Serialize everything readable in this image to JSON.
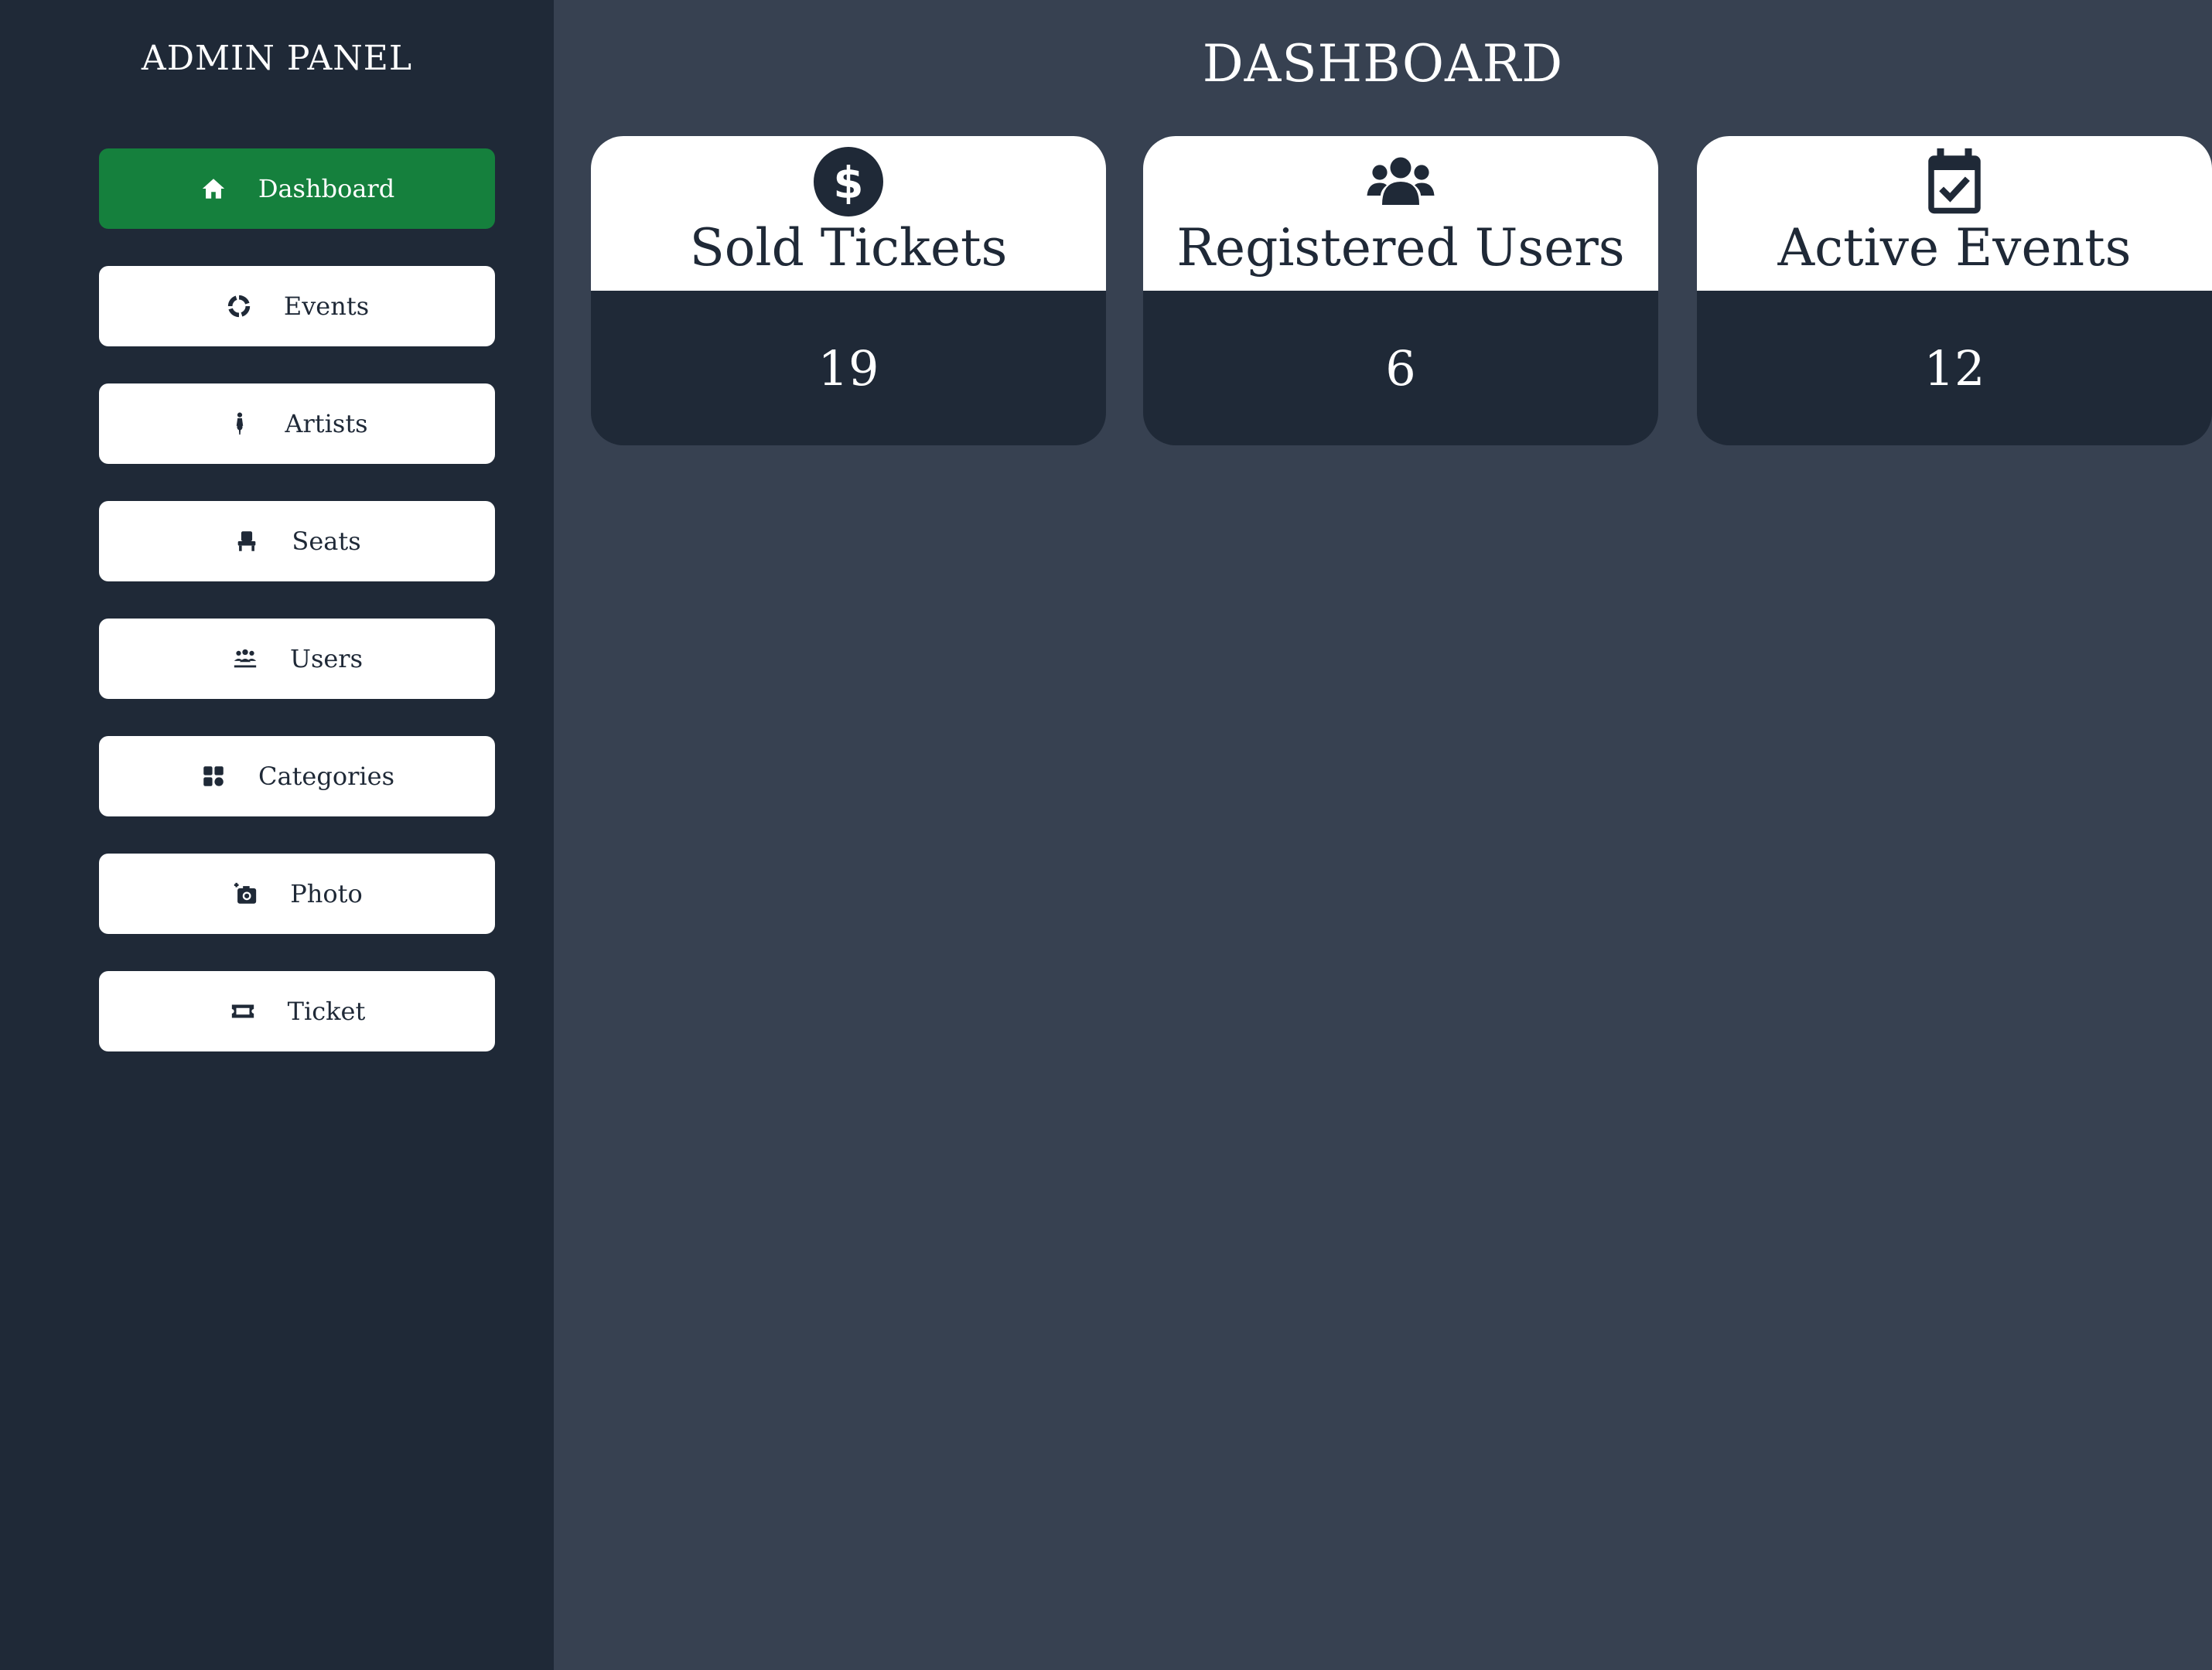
{
  "sidebar": {
    "title": "ADMIN PANEL",
    "items": [
      {
        "label": "Dashboard",
        "icon": "home-icon",
        "active": true
      },
      {
        "label": "Events",
        "icon": "circle-notch-icon",
        "active": false
      },
      {
        "label": "Artists",
        "icon": "person-guitar-icon",
        "active": false
      },
      {
        "label": "Seats",
        "icon": "chair-icon",
        "active": false
      },
      {
        "label": "Users",
        "icon": "people-group-icon",
        "active": false
      },
      {
        "label": "Categories",
        "icon": "grid-icon",
        "active": false
      },
      {
        "label": "Photo",
        "icon": "camera-plus-icon",
        "active": false
      },
      {
        "label": "Ticket",
        "icon": "ticket-icon",
        "active": false
      }
    ]
  },
  "main": {
    "title": "DASHBOARD",
    "cards": [
      {
        "title": "Sold Tickets",
        "value": "19",
        "icon": "dollar-circle-icon"
      },
      {
        "title": "Registered Users",
        "value": "6",
        "icon": "users-group-icon"
      },
      {
        "title": "Active Events",
        "value": "12",
        "icon": "calendar-check-icon"
      }
    ]
  },
  "colors": {
    "sidebar_bg": "#1f2937",
    "main_bg": "#374151",
    "active_item": "#15803d",
    "card_bg": "#ffffff"
  }
}
